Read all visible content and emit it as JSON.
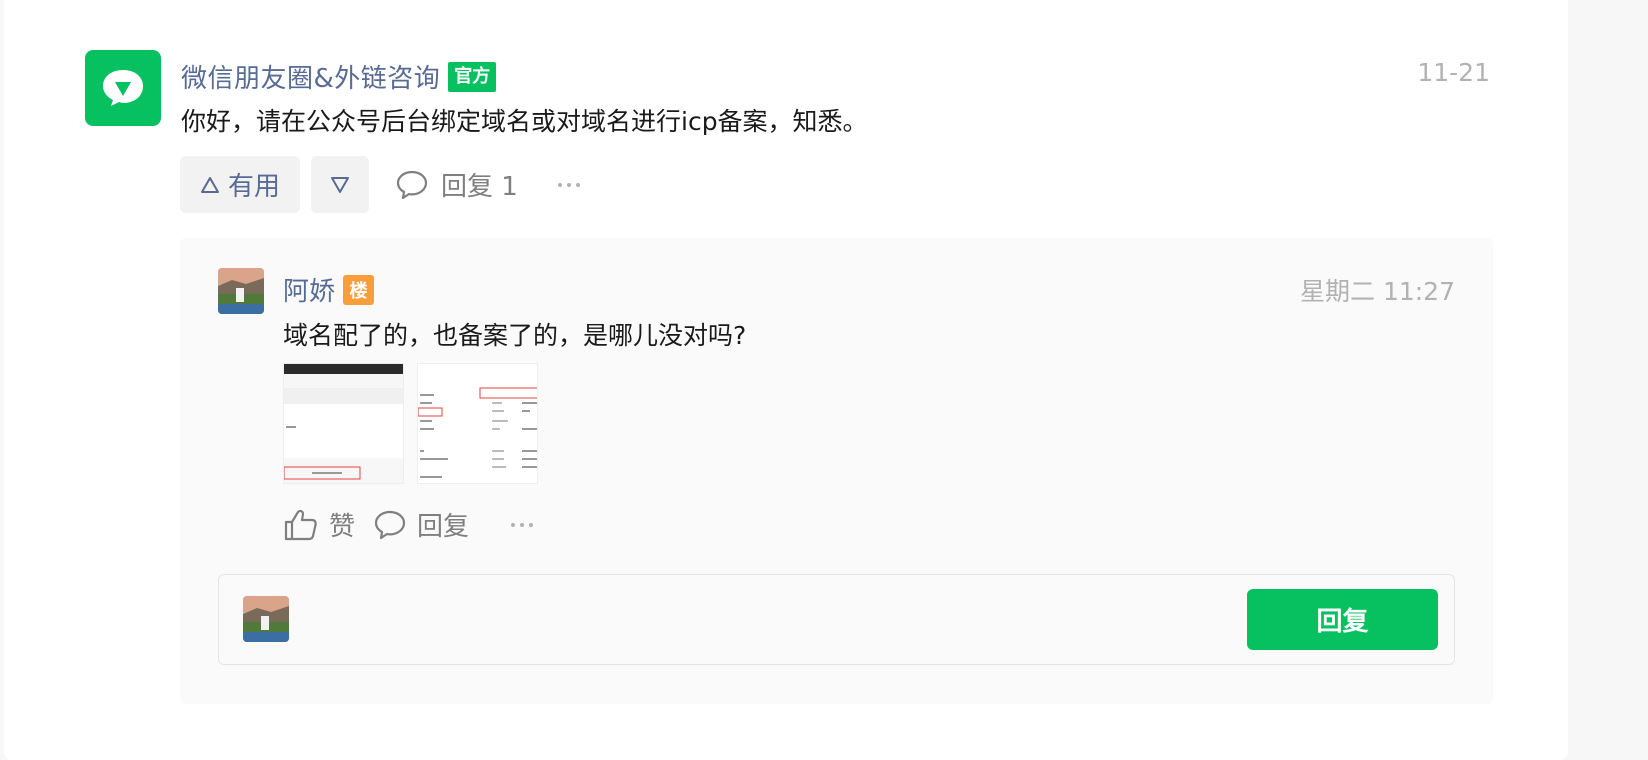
{
  "answer": {
    "author": "微信朋友圈&外链咨询",
    "badge": "官方",
    "date": "11-21",
    "text": "你好，请在公众号后台绑定域名或对域名进行icp备案，知悉。",
    "useful_label": "有用",
    "reply_count_label": "回复 1",
    "brand_color": "#07c160"
  },
  "reply": {
    "author": "阿娇",
    "floor_badge": "楼",
    "date": "星期二 11:27",
    "text": "域名配了的，也备案了的，是哪儿没对吗?",
    "like_label": "赞",
    "reply_label": "回复"
  },
  "compose": {
    "placeholder": "",
    "submit_label": "回复"
  },
  "icons": [
    "wechat-logo-icon",
    "triangle-up-icon",
    "triangle-down-icon",
    "comment-icon",
    "more-icon",
    "thumbs-up-icon"
  ]
}
